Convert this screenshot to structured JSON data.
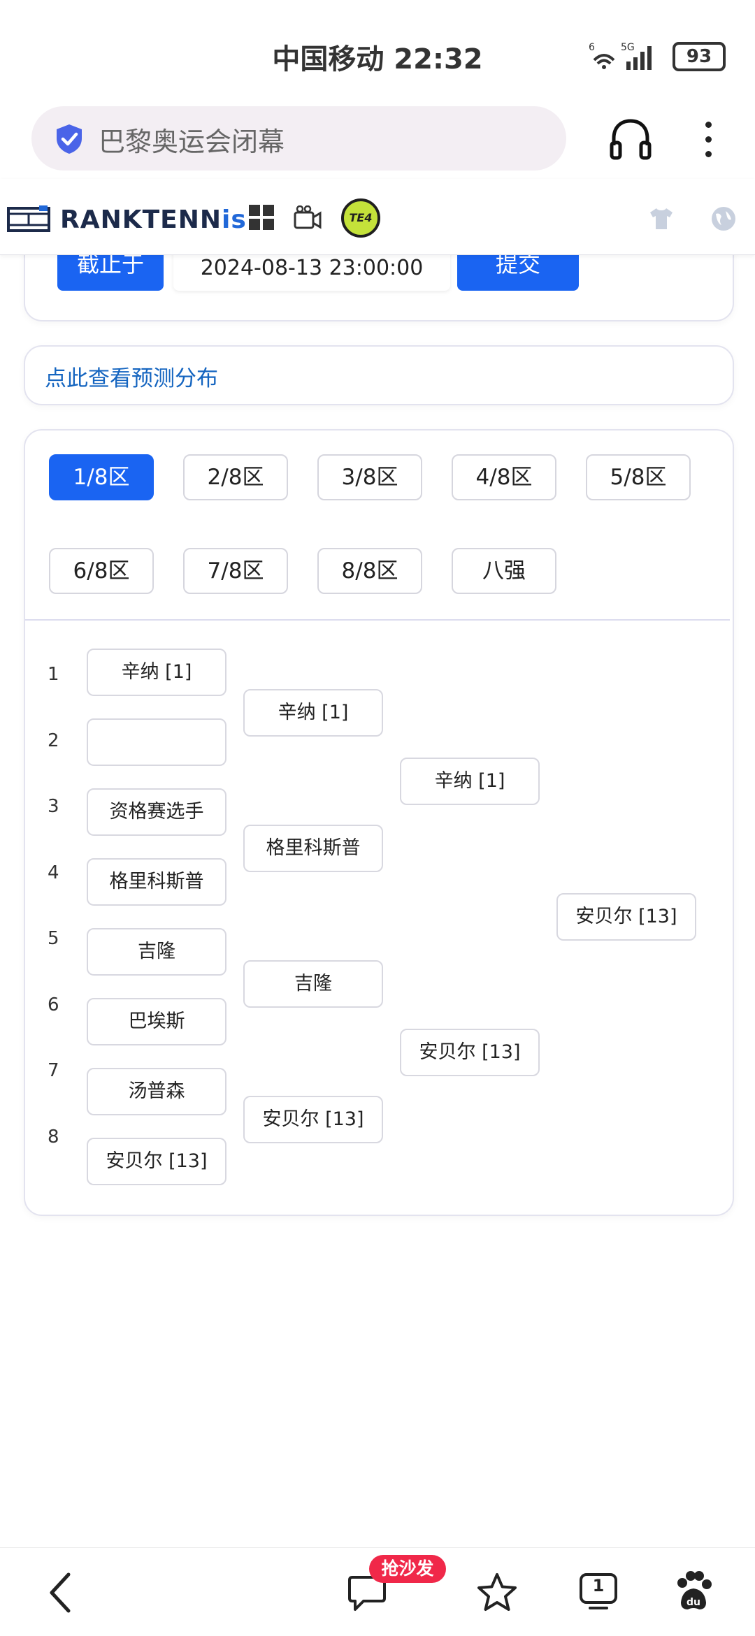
{
  "status_bar": {
    "carrier_time": "中国移动 22:32",
    "signal": "6 5G",
    "battery": "93"
  },
  "browser": {
    "search_query": "巴黎奥运会闭幕"
  },
  "site": {
    "logo_part1": "RANKTENN",
    "logo_part2": "is",
    "badge": "TE4"
  },
  "prediction": {
    "deadline_label": "截止于",
    "deadline_value": "2024-08-13 23:00:00",
    "submit_label": "提交",
    "distribution_link": "点此查看预测分布"
  },
  "regions": [
    "1/8区",
    "2/8区",
    "3/8区",
    "4/8区",
    "5/8区",
    "6/8区",
    "7/8区",
    "8/8区",
    "八强"
  ],
  "active_region": "1/8区",
  "bracket": {
    "seeds": [
      "1",
      "2",
      "3",
      "4",
      "5",
      "6",
      "7",
      "8"
    ],
    "round1": [
      "辛纳 [1]",
      "",
      "资格赛选手",
      "格里科斯普",
      "吉隆",
      "巴埃斯",
      "汤普森",
      "安贝尔 [13]"
    ],
    "round2": [
      "辛纳 [1]",
      "格里科斯普",
      "吉隆",
      "安贝尔 [13]"
    ],
    "round3": [
      "辛纳 [1]",
      "安贝尔 [13]"
    ],
    "winner": "安贝尔 [13]"
  },
  "bottom_nav": {
    "comment_badge": "抢沙发",
    "tab_count": "1"
  },
  "colors": {
    "accent": "#1a64f2",
    "link": "#1565c0",
    "badge": "#f02849"
  }
}
